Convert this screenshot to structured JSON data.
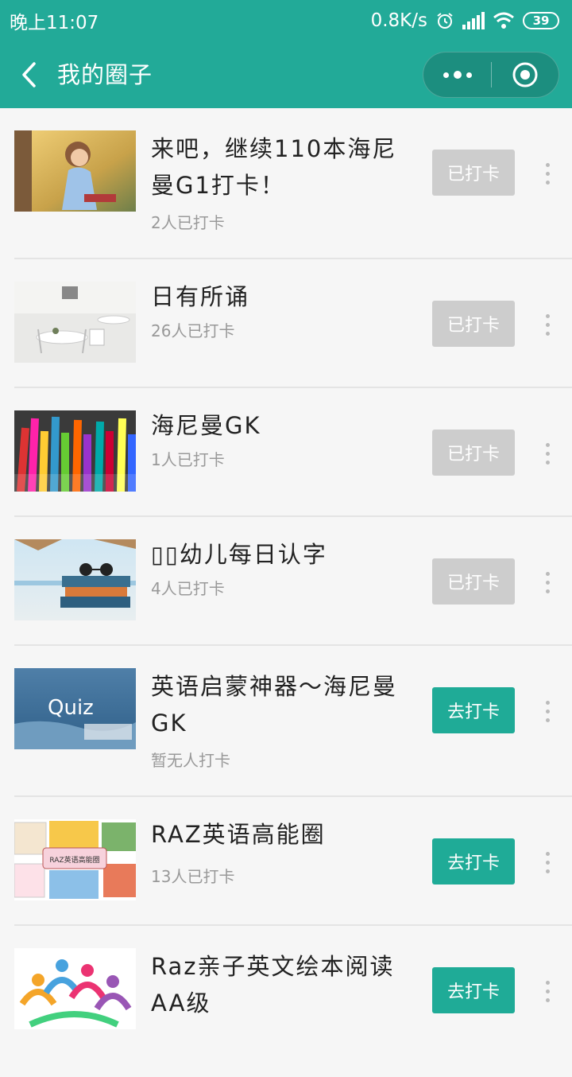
{
  "status_bar": {
    "time": "晚上11:07",
    "net_speed": "0.8K/s",
    "battery": "39"
  },
  "nav": {
    "title": "我的圈子"
  },
  "items": [
    {
      "title": "来吧，继续110本海尼曼G1打卡！",
      "count": "2人已打卡",
      "button": "已打卡",
      "state": "done",
      "thumb": "girl-reading-painting"
    },
    {
      "title": "日有所诵",
      "count": "26人已打卡",
      "button": "已打卡",
      "state": "done",
      "thumb": "white-cafe-room"
    },
    {
      "title": "海尼曼GK",
      "count": "1人已打卡",
      "button": "已打卡",
      "state": "done",
      "thumb": "colored-pencils"
    },
    {
      "title": "▯▯幼儿每日认字",
      "count": "4人已打卡",
      "button": "已打卡",
      "state": "done",
      "thumb": "books-sunglasses-beach"
    },
    {
      "title": "英语启蒙神器～海尼曼GK",
      "count": "暂无人打卡",
      "button": "去打卡",
      "state": "go",
      "thumb": "quiz-ocean",
      "thumb_text": "Quiz"
    },
    {
      "title": "RAZ英语高能圈",
      "count": "13人已打卡",
      "button": "去打卡",
      "state": "go",
      "thumb": "raz-books-collage",
      "thumb_text": "RAZ英语高能圈"
    },
    {
      "title": "Raz亲子英文绘本阅读AA级",
      "count": "",
      "button": "去打卡",
      "state": "go",
      "thumb": "colorful-people-logo"
    }
  ],
  "colors": {
    "brand": "#22aa98",
    "button_go": "#1fab97",
    "button_done": "#cdcdcd"
  }
}
